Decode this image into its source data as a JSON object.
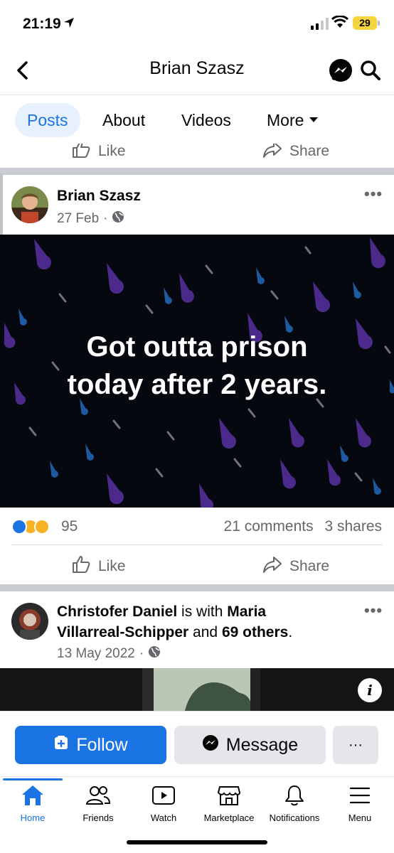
{
  "status": {
    "time": "21:19",
    "battery": "29"
  },
  "header": {
    "title": "Brian Szasz"
  },
  "tabs": [
    {
      "label": "Posts",
      "active": true
    },
    {
      "label": "About"
    },
    {
      "label": "Videos"
    },
    {
      "label": "More"
    }
  ],
  "actions": {
    "like": "Like",
    "share": "Share"
  },
  "post1": {
    "author": "Brian Szasz",
    "date": "27 Feb",
    "dot": "·",
    "text_line1": "Got outta prison",
    "text_line2": "today after 2 years.",
    "reaction_count": "95",
    "comments": "21 comments",
    "shares": "3 shares"
  },
  "post2": {
    "author": "Christofer Daniel",
    "with_text": "is with",
    "tagged": "Maria",
    "tagged2": "Villarreal-Schipper",
    "and_text": "and",
    "others": "69 others",
    "period": ".",
    "date": "13 May 2022",
    "dot": "·"
  },
  "buttons": {
    "follow": "Follow",
    "message": "Message",
    "more": "···"
  },
  "tabbar": [
    {
      "label": "Home",
      "active": true
    },
    {
      "label": "Friends"
    },
    {
      "label": "Watch"
    },
    {
      "label": "Marketplace"
    },
    {
      "label": "Notifications"
    },
    {
      "label": "Menu"
    }
  ],
  "colors": {
    "accent": "#1b74e4",
    "post_background": "#05090f",
    "battery": "#f5d53f"
  }
}
